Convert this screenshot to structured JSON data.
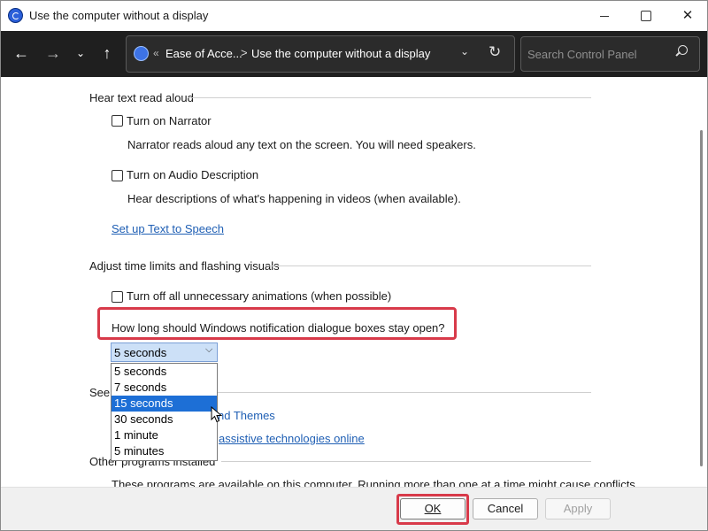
{
  "window": {
    "title": "Use the computer without a display",
    "minimize_glyph": "",
    "close_glyph": "✕"
  },
  "nav": {
    "back_glyph": "←",
    "forward_glyph": "→",
    "recent_glyph": "⌄",
    "up_glyph": "↑",
    "breadcrumb_sep": "«",
    "breadcrumb_1": "Ease of Acce...",
    "breadcrumb_arrow": ">",
    "breadcrumb_2": "Use the computer without a display",
    "dropdown_glyph": "⌄",
    "refresh_glyph": "↻",
    "search_placeholder": "Search Control Panel"
  },
  "sections": {
    "hear_text": {
      "heading": "Hear text read aloud",
      "narrator_label": "Turn on Narrator",
      "narrator_desc": "Narrator reads aloud any text on the screen. You will need speakers.",
      "audio_desc_label": "Turn on Audio Description",
      "audio_desc_desc": "Hear descriptions of what's happening in videos (when available).",
      "tts_link": "Set up Text to Speech"
    },
    "time_limits": {
      "heading": "Adjust time limits and flashing visuals",
      "animations_label": "Turn off all unnecessary animations (when possible)",
      "question": "How long should Windows notification dialogue boxes stay open?",
      "combo_value": "5 seconds",
      "combo_arrow": "⌵",
      "options": [
        "5 seconds",
        "7 seconds",
        "15 seconds",
        "30 seconds",
        "1 minute",
        "5 minutes"
      ],
      "highlighted_option": "15 seconds"
    },
    "see_also": {
      "heading_partial": "See a",
      "link_1_partial": "nd Themes",
      "link_2_partial": "assistive technologies online"
    },
    "other_programs": {
      "heading": "Other programs installed",
      "text": "These programs are available on this computer. Running more than one at a time might cause conflicts."
    }
  },
  "buttons": {
    "ok": "OK",
    "cancel": "Cancel",
    "apply": "Apply"
  },
  "colors": {
    "navbar_bg": "#1f1f1f",
    "link": "#1f5fb4",
    "highlight": "#d83a4a",
    "selected_option": "#1d6fd6"
  }
}
